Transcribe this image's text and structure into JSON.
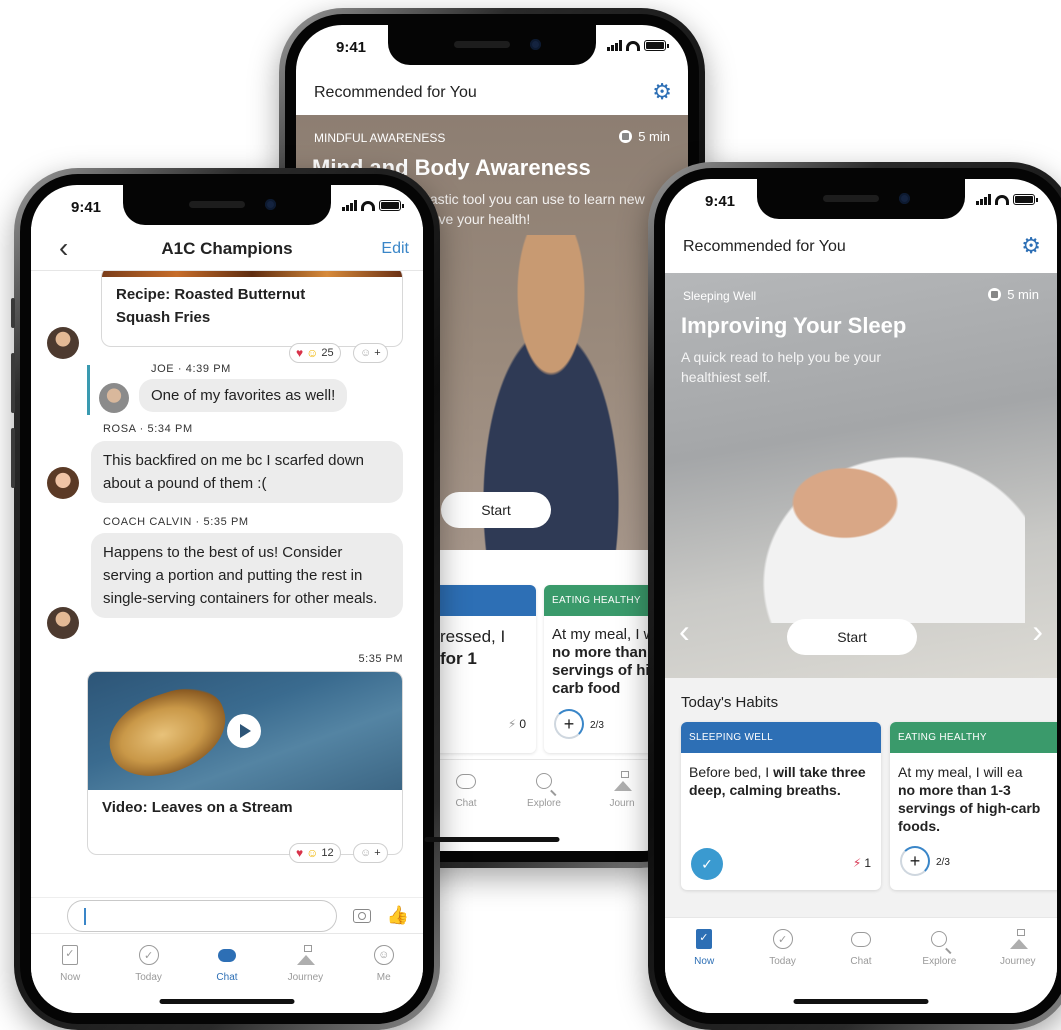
{
  "phone_chat": {
    "status": {
      "time": "9:41"
    },
    "nav": {
      "back": "‹",
      "title": "A1C Champions",
      "edit": "Edit"
    },
    "recipe_card": {
      "title": "Recipe: Roasted Butternut Squash Fries",
      "reaction_count": "25",
      "add_reaction": "+"
    },
    "joe": {
      "sender": "JOE · 4:39 PM",
      "text": "One of my favorites as well!"
    },
    "rosa": {
      "sender": "ROSA · 5:34 PM",
      "text": "This backfired on me bc I scarfed down about a pound of them :("
    },
    "coach": {
      "sender": "COACH CALVIN · 5:35 PM",
      "text": "Happens to the best of us! Consider serving a portion and putting the rest in single-serving containers for other meals."
    },
    "video_card": {
      "timestamp": "5:35 PM",
      "title": "Video: Leaves on a Stream",
      "reaction_count": "12",
      "add_reaction": "+"
    },
    "composer": {
      "placeholder": ""
    },
    "tabs": [
      {
        "label": "Now",
        "icon": "now-icon"
      },
      {
        "label": "Today",
        "icon": "today-icon"
      },
      {
        "label": "Chat",
        "icon": "chat-icon"
      },
      {
        "label": "Journey",
        "icon": "journey-icon"
      },
      {
        "label": "Me",
        "icon": "me-icon"
      }
    ],
    "active_tab": "Chat"
  },
  "phone_mindful": {
    "status": {
      "time": "9:41"
    },
    "header": "Recommended for You",
    "hero": {
      "category": "MINDFUL AWARENESS",
      "duration": "5 min",
      "title": "Mind and Body Awareness",
      "subtitle_visible": "tastic tool you can use to learn new",
      "subtitle_visible_2": "rove your health!",
      "start": "Start"
    },
    "habits": [
      {
        "header": "",
        "text_visible": "ressed, I",
        "bold_visible": "for 1",
        "streak": "0",
        "color": "#2d6fb5"
      },
      {
        "header": "EATING HEALTHY",
        "text_visible": "At my meal, I w",
        "bold_visible": "no more than 1 servings of high-carb food",
        "progress": "2/3",
        "color": "#3a9a6b"
      }
    ],
    "tabs": [
      {
        "label": "Chat",
        "icon": "chat-icon"
      },
      {
        "label": "Explore",
        "icon": "explore-icon"
      },
      {
        "label": "Journ",
        "icon": "journey-icon"
      }
    ]
  },
  "phone_sleep": {
    "status": {
      "time": "9:41"
    },
    "header": "Recommended for You",
    "hero": {
      "category": "Sleeping Well",
      "duration": "5 min",
      "title": "Improving Your Sleep",
      "subtitle": "A quick read to help you be your healthiest self.",
      "start": "Start",
      "prev": "‹",
      "next": "›"
    },
    "habits_title": "Today's Habits",
    "habits": [
      {
        "header": "SLEEPING WELL",
        "text": "Before bed, I ",
        "bold": "will take three deep, calming breaths.",
        "streak": "1",
        "color": "#2d6fb5"
      },
      {
        "header": "EATING HEALTHY",
        "text": "At my meal, I will ea",
        "bold": "no more than 1-3 servings of high-carb foods.",
        "progress": "2/3",
        "color": "#3a9a6b"
      }
    ],
    "tabs": [
      {
        "label": "Now",
        "icon": "now-icon"
      },
      {
        "label": "Today",
        "icon": "today-icon"
      },
      {
        "label": "Chat",
        "icon": "chat-icon"
      },
      {
        "label": "Explore",
        "icon": "explore-icon"
      },
      {
        "label": "Journey",
        "icon": "journey-icon"
      }
    ],
    "active_tab": "Now"
  },
  "colors": {
    "accent": "#2d6fb5",
    "link": "#3a86c8",
    "sleeping_well": "#2d6fb5",
    "eating_healthy": "#3a9a6b",
    "streak": "#d83a56"
  }
}
